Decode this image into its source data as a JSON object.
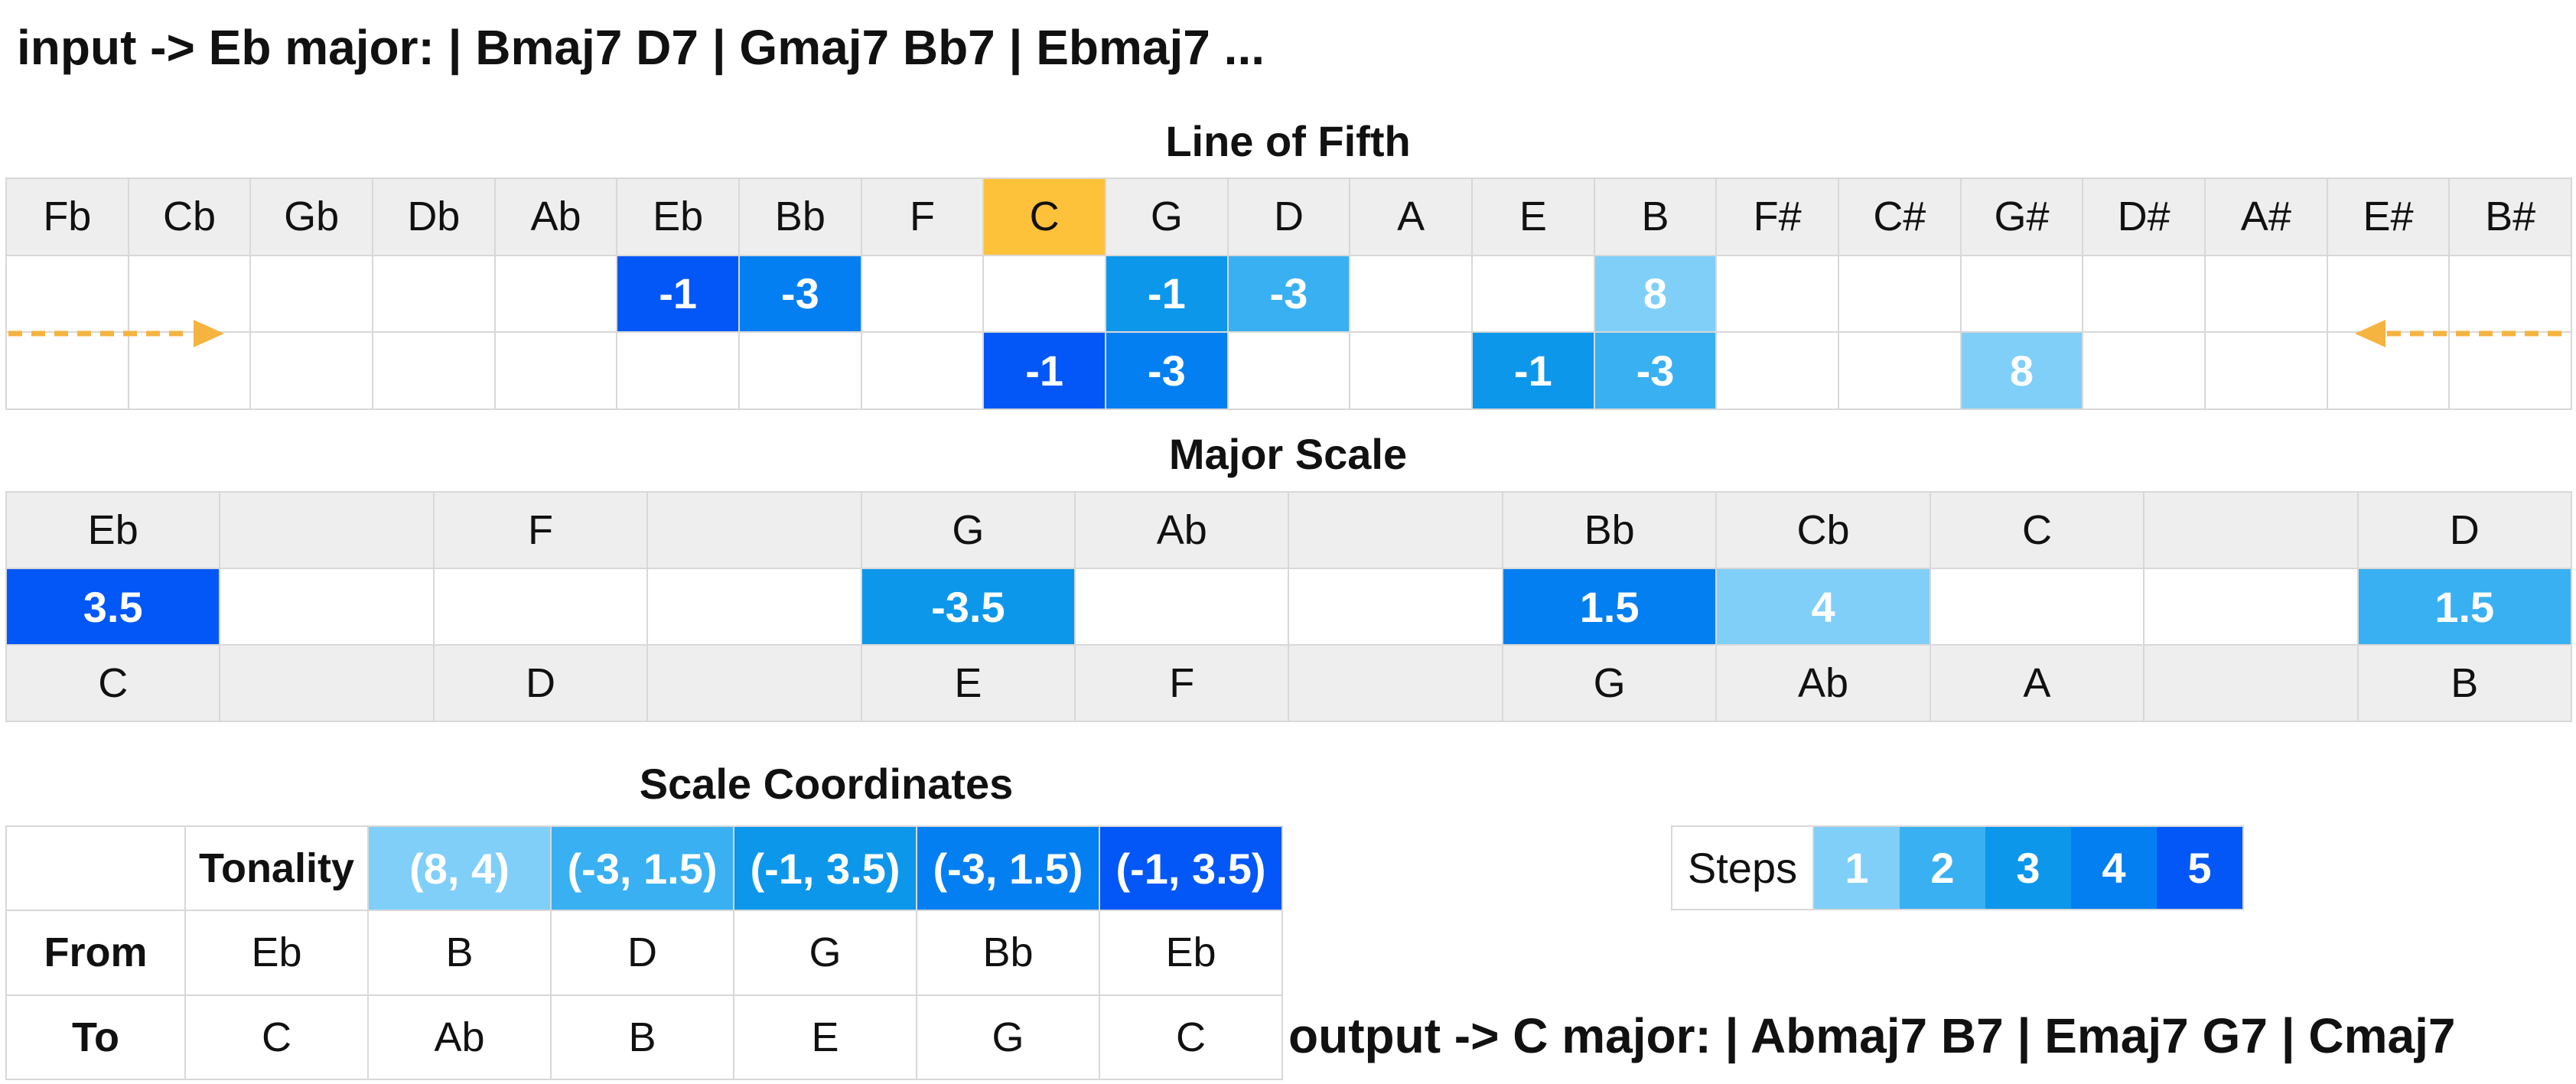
{
  "input_text": "input -> Eb major: | Bmaj7 D7 | Gmaj7 Bb7 | Ebmaj7 ...",
  "output_text": "output -> C major: | Abmaj7 B7 | Emaj7 G7 | Cmaj7",
  "colors": {
    "step1": "#80cff8",
    "step2": "#39b0f2",
    "step3": "#0c97eb",
    "step4": "#047ff2",
    "step5": "#0357f7",
    "highlight": "#fdc13a",
    "arrow": "#f5b340",
    "gray": "#eeeeee"
  },
  "line_of_fifth": {
    "title": "Line of Fifth",
    "notes": [
      "Fb",
      "Cb",
      "Gb",
      "Db",
      "Ab",
      "Eb",
      "Bb",
      "F",
      "C",
      "G",
      "D",
      "A",
      "E",
      "B",
      "F#",
      "C#",
      "G#",
      "D#",
      "A#",
      "E#",
      "B#"
    ],
    "highlight_note": "C",
    "row1": [
      null,
      null,
      null,
      null,
      null,
      {
        "value": "-1",
        "step": 5
      },
      {
        "value": "-3",
        "step": 4
      },
      null,
      null,
      {
        "value": "-1",
        "step": 3
      },
      {
        "value": "-3",
        "step": 2
      },
      null,
      null,
      {
        "value": "8",
        "step": 1
      },
      null,
      null,
      null,
      null,
      null,
      null,
      null
    ],
    "row2": [
      null,
      null,
      null,
      null,
      null,
      null,
      null,
      null,
      {
        "value": "-1",
        "step": 5
      },
      {
        "value": "-3",
        "step": 4
      },
      null,
      null,
      {
        "value": "-1",
        "step": 3
      },
      {
        "value": "-3",
        "step": 2
      },
      null,
      null,
      {
        "value": "8",
        "step": 1
      },
      null,
      null,
      null,
      null
    ]
  },
  "major_scale": {
    "title": "Major Scale",
    "top_notes": [
      "Eb",
      "",
      "F",
      "",
      "G",
      "Ab",
      "",
      "Bb",
      "Cb",
      "C",
      "",
      "D"
    ],
    "values": [
      {
        "value": "3.5",
        "step": 5
      },
      null,
      null,
      null,
      {
        "value": "-3.5",
        "step": 3
      },
      null,
      null,
      {
        "value": "1.5",
        "step": 4
      },
      {
        "value": "4",
        "step": 1
      },
      null,
      null,
      {
        "value": "1.5",
        "step": 2
      }
    ],
    "bottom_notes": [
      "C",
      "",
      "D",
      "",
      "E",
      "F",
      "",
      "G",
      "Ab",
      "A",
      "",
      "B"
    ]
  },
  "scale_coordinates": {
    "title": "Scale Coordinates",
    "row_labels": [
      "Tonality",
      "From",
      "To"
    ],
    "tonality": [
      {
        "value": "(8, 4)",
        "step": 1
      },
      {
        "value": "(-3, 1.5)",
        "step": 2
      },
      {
        "value": "(-1, 3.5)",
        "step": 3
      },
      {
        "value": "(-3, 1.5)",
        "step": 4
      },
      {
        "value": "(-1, 3.5)",
        "step": 5
      }
    ],
    "from": [
      "Eb",
      "B",
      "D",
      "G",
      "Bb",
      "Eb"
    ],
    "to": [
      "C",
      "Ab",
      "B",
      "E",
      "G",
      "C"
    ]
  },
  "steps_legend": {
    "label": "Steps",
    "items": [
      "1",
      "2",
      "3",
      "4",
      "5"
    ]
  }
}
